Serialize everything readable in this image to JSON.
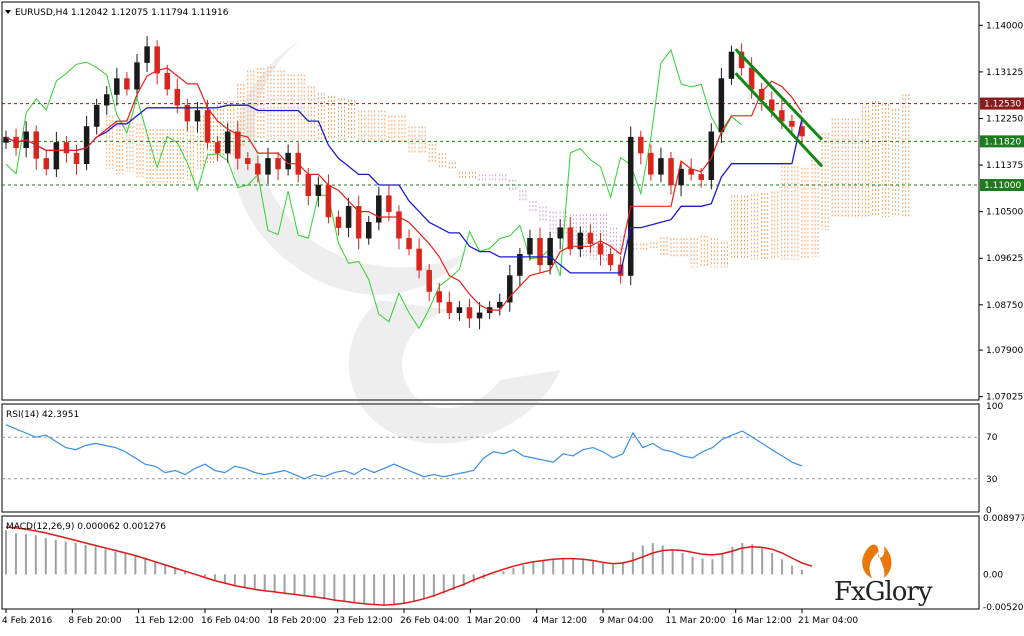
{
  "chart_data": [
    {
      "type": "candlestick",
      "title": "EURUSD,H4  1.12042 1.12075 1.11794 1.11916",
      "symbol": "EURUSD,H4",
      "ohlc_header": {
        "open": 1.12042,
        "high": 1.12075,
        "low": 1.11794,
        "close": 1.11916
      },
      "ylim": [
        1.07,
        1.144
      ],
      "y_ticks": [
        "1.14000",
        "1.13125",
        "1.12250",
        "1.11375",
        "1.10500",
        "1.09625",
        "1.08750",
        "1.07900",
        "1.07025"
      ],
      "y_tick_values": [
        1.14,
        1.13125,
        1.1225,
        1.11375,
        1.105,
        1.09625,
        1.0875,
        1.079,
        1.07025
      ],
      "horizontal_levels": [
        {
          "label": "1.12530",
          "value": 1.1253,
          "color": "#8b1a1a"
        },
        {
          "label": "1.11820",
          "value": 1.1182,
          "color": "#1e7a1e"
        },
        {
          "label": "1.11000",
          "value": 1.11,
          "color": "#1e7a1e"
        }
      ],
      "price_tags": [
        {
          "label": "1.12530",
          "value": 1.1253,
          "color": "#8b1a1a"
        },
        {
          "label": "1.11820",
          "value": 1.1182,
          "color": "#1e7a1e"
        },
        {
          "label": "1.11000",
          "value": 1.11,
          "color": "#1e7a1e"
        }
      ],
      "close_series": [
        1.119,
        1.117,
        1.12,
        1.115,
        1.113,
        1.118,
        1.116,
        1.114,
        1.121,
        1.125,
        1.127,
        1.13,
        1.128,
        1.133,
        1.136,
        1.131,
        1.128,
        1.125,
        1.122,
        1.124,
        1.118,
        1.116,
        1.12,
        1.115,
        1.114,
        1.112,
        1.115,
        1.113,
        1.116,
        1.112,
        1.108,
        1.11,
        1.104,
        1.102,
        1.106,
        1.1,
        1.103,
        1.108,
        1.105,
        1.1,
        1.098,
        1.094,
        1.09,
        1.088,
        1.086,
        1.087,
        1.085,
        1.086,
        1.087,
        1.088,
        1.093,
        1.097,
        1.1,
        1.095,
        1.1,
        1.102,
        1.098,
        1.101,
        1.099,
        1.097,
        1.095,
        1.093,
        1.119,
        1.116,
        1.112,
        1.115,
        1.11,
        1.113,
        1.112,
        1.111,
        1.12,
        1.13,
        1.135,
        1.132,
        1.128,
        1.126,
        1.124,
        1.122,
        1.121,
        1.1192
      ],
      "indicators": [
        "Tenkan-sen",
        "Kijun-sen",
        "Chikou Span",
        "Kumo cloud",
        "Descending channel"
      ],
      "channel_lines": [
        {
          "from": {
            "x": "16 Mar 12:00",
            "y": 1.1355
          },
          "to": {
            "x": "21 Mar 04:00",
            "y": 1.1185
          }
        },
        {
          "from": {
            "x": "16 Mar 12:00",
            "y": 1.131
          },
          "to": {
            "x": "21 Mar 04:00",
            "y": 1.1135
          }
        }
      ]
    },
    {
      "type": "line",
      "title": "RSI(14) 42.3951",
      "ylim": [
        0,
        100
      ],
      "y_ticks": [
        "100",
        "70",
        "30",
        "0"
      ],
      "y_tick_values": [
        100,
        70,
        30,
        0
      ],
      "levels": [
        70,
        30
      ],
      "values": [
        82,
        78,
        74,
        70,
        72,
        66,
        60,
        58,
        62,
        64,
        62,
        60,
        56,
        50,
        44,
        42,
        36,
        38,
        34,
        40,
        44,
        38,
        36,
        42,
        40,
        36,
        34,
        36,
        38,
        34,
        30,
        34,
        32,
        36,
        38,
        34,
        40,
        36,
        40,
        44,
        40,
        36,
        32,
        34,
        32,
        34,
        36,
        38,
        50,
        56,
        54,
        58,
        52,
        50,
        48,
        46,
        54,
        52,
        58,
        60,
        56,
        50,
        54,
        74,
        60,
        64,
        58,
        56,
        52,
        50,
        56,
        60,
        68,
        72,
        76,
        70,
        64,
        58,
        52,
        46,
        42.3951
      ],
      "current": 42.3951
    },
    {
      "type": "bar",
      "title": "MACD(12,26,9) 0.000062 0.001276",
      "ylim": [
        -0.005205,
        0.008977
      ],
      "y_ticks": [
        "0.008977",
        "0.00",
        "-0.005205"
      ],
      "y_tick_values": [
        0.008977,
        0.0,
        -0.005205
      ],
      "histogram": [
        0.007,
        0.0065,
        0.0064,
        0.0062,
        0.0058,
        0.0055,
        0.0052,
        0.005,
        0.0047,
        0.0044,
        0.004,
        0.0036,
        0.0033,
        0.003,
        0.0026,
        0.0021,
        0.0016,
        0.0011,
        0.0006,
        0.0001,
        -0.0004,
        -0.0009,
        -0.0013,
        -0.0017,
        -0.002,
        -0.0023,
        -0.0026,
        -0.0028,
        -0.003,
        -0.0032,
        -0.0034,
        -0.0036,
        -0.0038,
        -0.004,
        -0.0042,
        -0.0044,
        -0.0046,
        -0.0047,
        -0.0048,
        -0.0047,
        -0.0045,
        -0.0043,
        -0.004,
        -0.0036,
        -0.0031,
        -0.0025,
        -0.0019,
        -0.0013,
        -0.0007,
        -0.0001,
        0.0005,
        0.001,
        0.0015,
        0.0019,
        0.0022,
        0.0024,
        0.0025,
        0.0026,
        0.0024,
        0.0021,
        0.0018,
        0.0015,
        0.002,
        0.0035,
        0.0046,
        0.005,
        0.0046,
        0.004,
        0.0034,
        0.0028,
        0.0025,
        0.0024,
        0.0032,
        0.0044,
        0.005,
        0.0048,
        0.0042,
        0.0034,
        0.0024,
        0.0014,
        0.0007
      ],
      "signal": [
        0.0075,
        0.0074,
        0.0072,
        0.0069,
        0.0066,
        0.0062,
        0.0058,
        0.0054,
        0.005,
        0.0046,
        0.0042,
        0.0038,
        0.0034,
        0.003,
        0.0025,
        0.002,
        0.0015,
        0.001,
        0.0005,
        0.0,
        -0.0005,
        -0.001,
        -0.0014,
        -0.0018,
        -0.0021,
        -0.0024,
        -0.0026,
        -0.0028,
        -0.003,
        -0.0032,
        -0.0034,
        -0.0036,
        -0.0038,
        -0.0041,
        -0.0043,
        -0.0045,
        -0.0047,
        -0.0048,
        -0.0049,
        -0.0048,
        -0.0046,
        -0.0043,
        -0.0039,
        -0.0034,
        -0.0028,
        -0.0022,
        -0.0016,
        -0.0009,
        -0.0003,
        0.0003,
        0.0008,
        0.0013,
        0.0017,
        0.002,
        0.0022,
        0.0024,
        0.0025,
        0.0025,
        0.0024,
        0.0022,
        0.0019,
        0.0017,
        0.0018,
        0.0022,
        0.0028,
        0.0034,
        0.0038,
        0.0039,
        0.0038,
        0.0035,
        0.0032,
        0.0031,
        0.0033,
        0.0037,
        0.0042,
        0.0044,
        0.0043,
        0.004,
        0.0034,
        0.0026,
        0.0018,
        0.0013
      ],
      "values": {
        "macd": 6.2e-05,
        "signal": 0.001276
      }
    }
  ],
  "x_axis": {
    "labels": [
      "4 Feb 2016",
      "8 Feb 20:00",
      "11 Feb 12:00",
      "16 Feb 04:00",
      "18 Feb 20:00",
      "23 Feb 12:00",
      "26 Feb 04:00",
      "1 Mar 20:00",
      "4 Mar 12:00",
      "9 Mar 04:00",
      "11 Mar 20:00",
      "16 Mar 12:00",
      "21 Mar 04:00"
    ]
  },
  "brand": {
    "text": "FxGlory"
  },
  "colors": {
    "tenkan": "#e8201c",
    "kijun": "#1c1ccc",
    "chikou": "#2fd22f",
    "kumo": "#f4a460",
    "kumo_alt": "#c8a8c8",
    "bull_candle": "#1a1a1a",
    "bear_candle": "#d8261c",
    "channel": "#118811",
    "rsi": "#3a8ee6",
    "macd_signal": "#e01818",
    "macd_hist": "#a0a0a0",
    "brand_flame": "#e8780a"
  }
}
